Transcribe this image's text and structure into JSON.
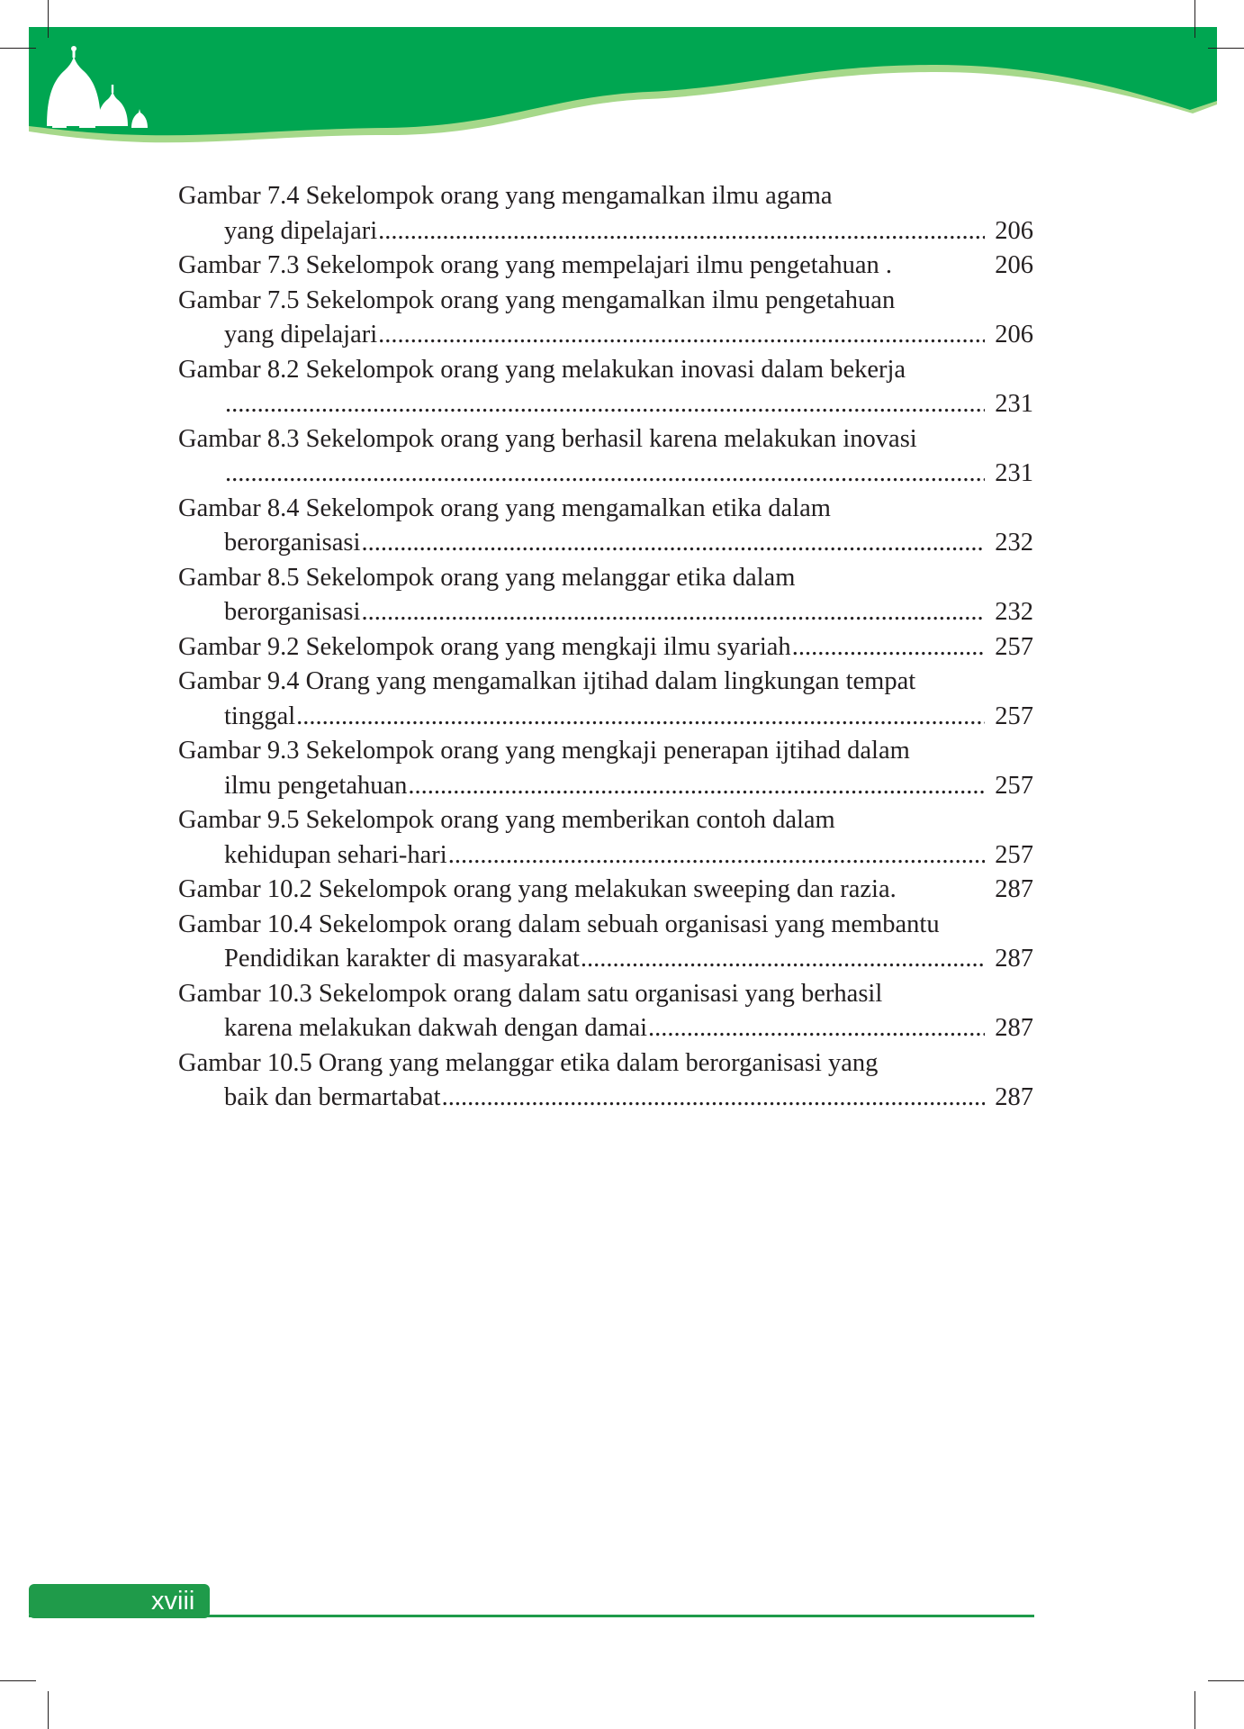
{
  "colors": {
    "banner_green": "#00a651",
    "light_green": "#a6d88a",
    "footer_green": "#1f9b4a"
  },
  "icons": {
    "mosque": "mosque-silhouette-icon"
  },
  "entries": [
    {
      "lines": [
        "Gambar 7.4 Sekelompok orang yang mengamalkan ilmu agama",
        "yang dipelajari"
      ],
      "page": "206",
      "dots": true
    },
    {
      "lines": [
        "Gambar 7.3 Sekelompok orang yang mempelajari ilmu pengetahuan ."
      ],
      "page": "206",
      "dots": false
    },
    {
      "lines": [
        "Gambar 7.5 Sekelompok orang yang mengamalkan ilmu pengetahuan",
        "yang dipelajari"
      ],
      "page": "206",
      "dots": true
    },
    {
      "lines": [
        "Gambar 8.2 Sekelompok orang yang melakukan inovasi dalam bekerja",
        ""
      ],
      "page": "231",
      "dots": true
    },
    {
      "lines": [
        "Gambar 8.3 Sekelompok orang yang berhasil karena melakukan inovasi",
        ""
      ],
      "page": "231",
      "dots": true
    },
    {
      "lines": [
        "Gambar 8.4 Sekelompok orang yang mengamalkan etika dalam",
        "berorganisasi"
      ],
      "page": "232",
      "dots": true
    },
    {
      "lines": [
        "Gambar 8.5 Sekelompok orang yang melanggar etika dalam",
        "berorganisasi"
      ],
      "page": "232",
      "dots": true
    },
    {
      "lines": [
        "Gambar 9.2 Sekelompok orang yang mengkaji ilmu syariah "
      ],
      "page": "257",
      "dots": true
    },
    {
      "lines": [
        "Gambar 9.4 Orang yang mengamalkan ijtihad dalam lingkungan tempat",
        "tinggal"
      ],
      "page": "257",
      "dots": true
    },
    {
      "lines": [
        "Gambar 9.3 Sekelompok orang yang mengkaji penerapan ijtihad dalam",
        "ilmu pengetahuan "
      ],
      "page": "257",
      "dots": true
    },
    {
      "lines": [
        "Gambar 9.5 Sekelompok orang yang memberikan contoh dalam",
        "kehidupan sehari-hari"
      ],
      "page": "257",
      "dots": true
    },
    {
      "lines": [
        "Gambar 10.2 Sekelompok orang yang melakukan sweeping dan razia."
      ],
      "page": "287",
      "dots": false
    },
    {
      "lines": [
        "Gambar 10.4 Sekelompok orang dalam sebuah organisasi yang membantu",
        "Pendidikan karakter di masyarakat "
      ],
      "page": "287",
      "dots": true
    },
    {
      "lines": [
        "Gambar 10.3 Sekelompok orang dalam satu organisasi yang berhasil",
        "karena melakukan dakwah dengan damai"
      ],
      "page": "287",
      "dots": true
    },
    {
      "lines": [
        "Gambar 10.5 Orang yang melanggar etika dalam berorganisasi yang",
        "baik dan bermartabat"
      ],
      "page": "287",
      "dots": true
    }
  ],
  "footer": {
    "page_label": "xviii"
  }
}
